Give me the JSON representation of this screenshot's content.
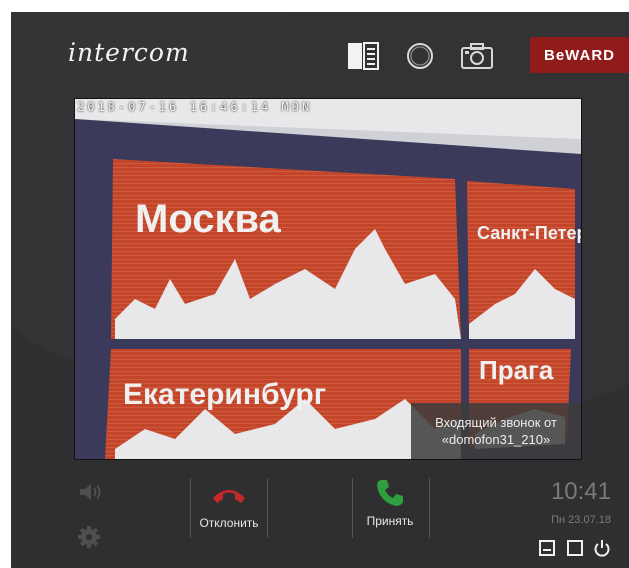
{
  "header": {
    "logo": "intercom",
    "brand": "BeWARD",
    "icons": [
      "layout-panel-icon",
      "circle-icon",
      "camera-icon"
    ]
  },
  "video": {
    "timestamp": "2018-07-16 16:46:14 MON",
    "scene_text": [
      "Москва",
      "Санкт-Петербург",
      "Екатеринбург",
      "Прага"
    ],
    "notice_line1": "Входящий звонок от",
    "notice_line2": "«domofon31_210»"
  },
  "controls": {
    "decline_label": "Отклонить",
    "accept_label": "Принять",
    "icons": [
      "speaker-icon",
      "gear-icon",
      "minimize-icon",
      "window-icon",
      "power-icon"
    ]
  },
  "clock": {
    "time": "10:41",
    "date": "Пн 23.07.18"
  },
  "colors": {
    "background": "#2f2f31",
    "brand": "#8f1b1b",
    "decline": "#c62828",
    "accept": "#2e9e3e"
  }
}
